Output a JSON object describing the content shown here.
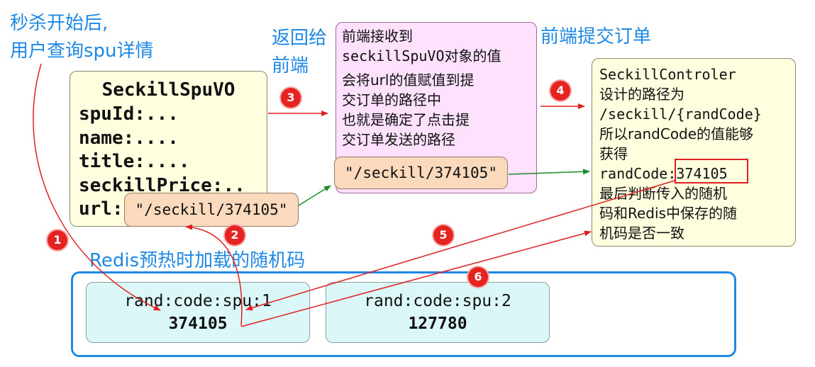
{
  "annotations": {
    "start_line1": "秒杀开始后,",
    "start_line2": "用户查询spu详情",
    "return_line1": "返回给",
    "return_line2": "前端",
    "submit": "前端提交订单",
    "redis_title": "Redis预热时加载的随机码"
  },
  "vo_box": {
    "title": "SeckillSpuVO",
    "fields": [
      "spuId:...",
      "name:....",
      "title:....",
      "seckillPrice:.."
    ],
    "url_key": "url:",
    "url_value": "\"/seckill/374105\""
  },
  "frontend_box": {
    "lines": [
      "前端接收到",
      "seckillSpuVO对象的值",
      "会将url的值赋值到提",
      "交订单的路径中",
      "也就是确定了点击提",
      "交订单发送的路径"
    ],
    "path": "\"/seckill/374105\""
  },
  "controller_box": {
    "lines_before": [
      "SeckillControler",
      "设计的路径为",
      "/seckill/{randCode}",
      "所以randCode的值能够",
      "获得"
    ],
    "randcode_key": "randCode:",
    "randcode_value": "374105",
    "lines_after": [
      "最后判断传入的随机",
      "码和Redis中保存的随",
      "机码是否一致"
    ]
  },
  "redis_entries": [
    {
      "key": "rand:code:spu:1",
      "value": "374105"
    },
    {
      "key": "rand:code:spu:2",
      "value": "127780"
    }
  ],
  "steps": [
    "1",
    "2",
    "3",
    "4",
    "5",
    "6"
  ],
  "colors": {
    "label_blue": "#1e88e5",
    "arrow_red": "#e02020",
    "arrow_green": "#1a8a2a",
    "badge_red": "#e52421"
  }
}
